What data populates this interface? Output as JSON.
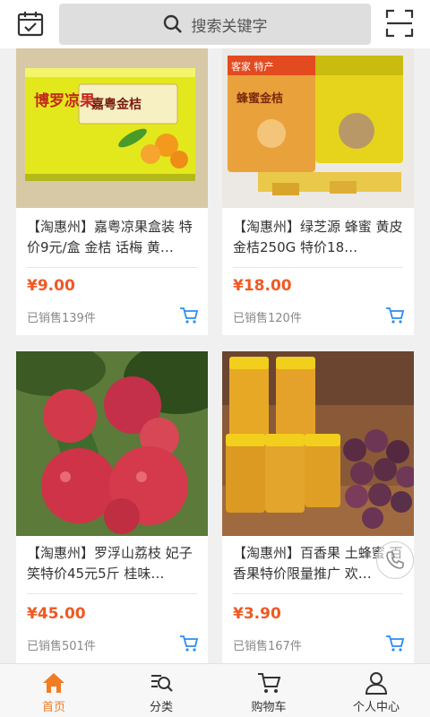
{
  "header": {
    "search_placeholder": "搜索关键字"
  },
  "products": [
    {
      "title": "【淘惠州】嘉粤凉果盒装 特价9元/盒 金桔 话梅 黄…",
      "price": "¥9.00",
      "sold": "已销售139件",
      "image_label_brand": "博罗凉果",
      "image_label_tag": "嘉粤金桔"
    },
    {
      "title": "【淘惠州】绿芝源 蜂蜜 黄皮金桔250G 特价18…",
      "price": "¥18.00",
      "sold": "已销售120件",
      "image_label_brand": "客家 特产",
      "image_label_tag": "蜂蜜金桔"
    },
    {
      "title": "【淘惠州】罗浮山荔枝 妃子笑特价45元5斤 桂味…",
      "price": "¥45.00",
      "sold": "已销售501件"
    },
    {
      "title": "【淘惠州】百香果 土蜂蜜 百香果特价限量推广 欢…",
      "price": "¥3.90",
      "sold": "已销售167件"
    }
  ],
  "tabs": [
    {
      "label": "首页",
      "icon": "home-icon",
      "active": true
    },
    {
      "label": "分类",
      "icon": "category-search-icon",
      "active": false
    },
    {
      "label": "购物车",
      "icon": "cart-icon",
      "active": false
    },
    {
      "label": "个人中心",
      "icon": "user-icon",
      "active": false
    }
  ],
  "colors": {
    "accent": "#f07c24",
    "price": "#ee5a24",
    "cart_icon": "#2d8cf0"
  }
}
